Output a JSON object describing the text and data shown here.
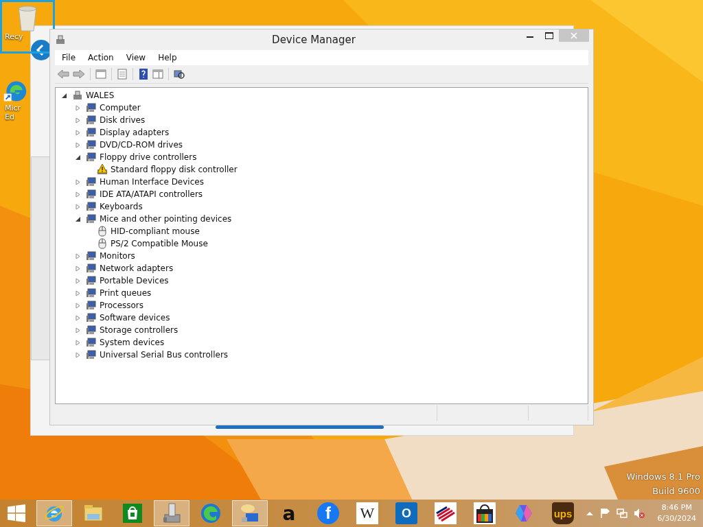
{
  "desktop": {
    "icons": [
      {
        "kind": "recycle-bin",
        "label": "Recy",
        "selected": true
      },
      {
        "kind": "edge",
        "label": "Micr\nEd",
        "selected": false
      }
    ],
    "watermark": [
      "Windows 8.1 Pro",
      "Build 9600"
    ]
  },
  "window": {
    "title": "Device Manager"
  },
  "menu": [
    "File",
    "Action",
    "View",
    "Help"
  ],
  "tree": {
    "label": "WALES",
    "expanded": true,
    "children": [
      {
        "label": "Computer",
        "expanded": false
      },
      {
        "label": "Disk drives",
        "expanded": false
      },
      {
        "label": "Display adapters",
        "expanded": false
      },
      {
        "label": "DVD/CD-ROM drives",
        "expanded": false
      },
      {
        "label": "Floppy drive controllers",
        "expanded": true,
        "children": [
          {
            "label": "Standard floppy disk controller",
            "warning": true
          }
        ]
      },
      {
        "label": "Human Interface Devices",
        "expanded": false
      },
      {
        "label": "IDE ATA/ATAPI controllers",
        "expanded": false
      },
      {
        "label": "Keyboards",
        "expanded": false
      },
      {
        "label": "Mice and other pointing devices",
        "expanded": true,
        "children": [
          {
            "label": "HID-compliant mouse",
            "warning": false
          },
          {
            "label": "PS/2 Compatible Mouse",
            "warning": false
          }
        ]
      },
      {
        "label": "Monitors",
        "expanded": false
      },
      {
        "label": "Network adapters",
        "expanded": false
      },
      {
        "label": "Portable Devices",
        "expanded": false
      },
      {
        "label": "Print queues",
        "expanded": false
      },
      {
        "label": "Processors",
        "expanded": false
      },
      {
        "label": "Software devices",
        "expanded": false
      },
      {
        "label": "Storage controllers",
        "expanded": false
      },
      {
        "label": "System devices",
        "expanded": false
      },
      {
        "label": "Universal Serial Bus controllers",
        "expanded": false
      }
    ]
  },
  "taskbar": {
    "items": [
      {
        "kind": "ie",
        "selected": true
      },
      {
        "kind": "explorer",
        "selected": false
      },
      {
        "kind": "store",
        "selected": false
      },
      {
        "kind": "device-manager",
        "selected": true
      },
      {
        "kind": "edge",
        "selected": false
      },
      {
        "kind": "chat",
        "selected": true
      },
      {
        "kind": "amazon",
        "glyph": "a",
        "selected": false
      },
      {
        "kind": "facebook",
        "glyph": "f",
        "selected": false
      },
      {
        "kind": "wikipedia",
        "glyph": "W",
        "selected": false
      },
      {
        "kind": "outlook",
        "glyph": "O",
        "selected": false
      },
      {
        "kind": "bank",
        "selected": false
      },
      {
        "kind": "bag",
        "selected": false
      },
      {
        "kind": "copilot",
        "selected": false
      },
      {
        "kind": "ups",
        "glyph": "ups",
        "selected": false
      }
    ],
    "clock": {
      "time": "8:46 PM",
      "date": "6/30/2024"
    }
  }
}
